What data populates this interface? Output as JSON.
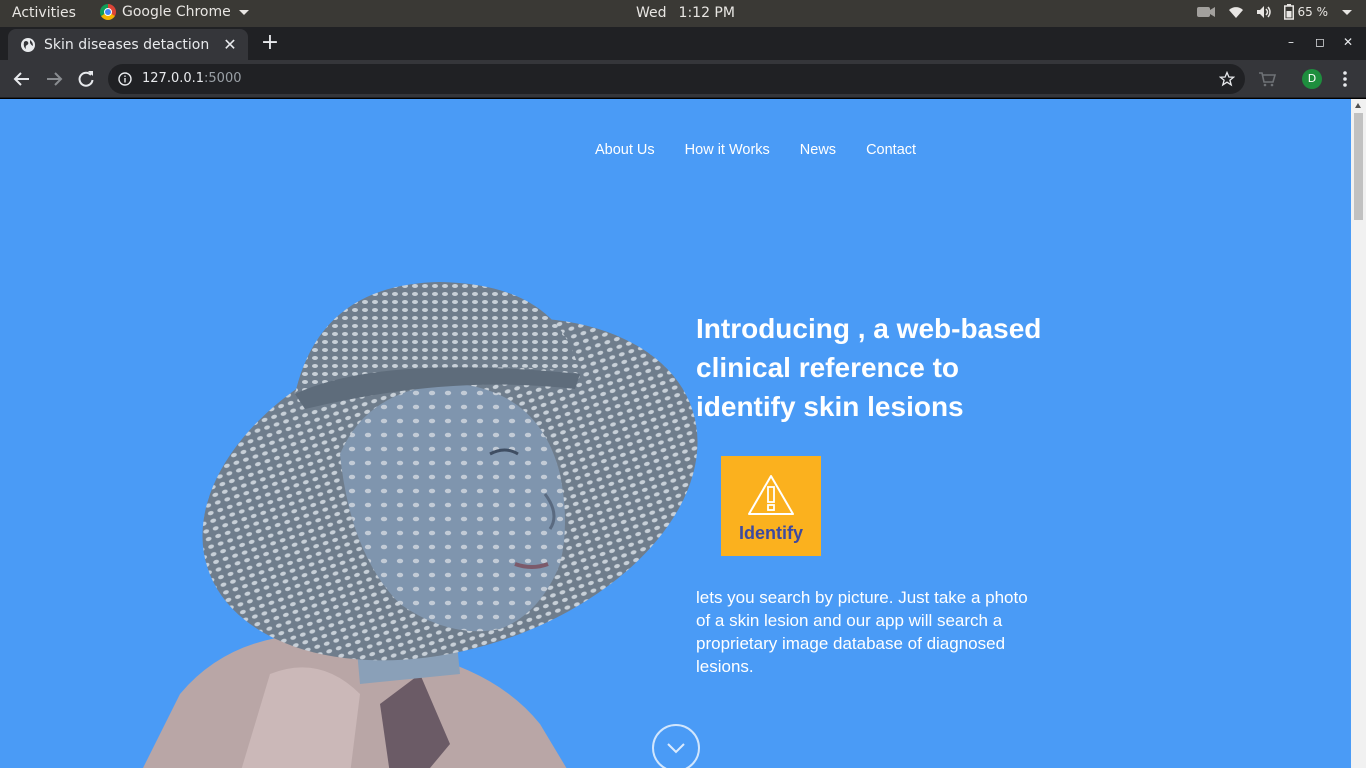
{
  "system_bar": {
    "activities": "Activities",
    "app_name": "Google Chrome",
    "day": "Wed",
    "time": "1:12 PM",
    "battery": "65 %"
  },
  "browser": {
    "tab_title": "Skin diseases detaction",
    "url_host": "127.0.0.1",
    "url_port": ":5000",
    "profile_initial": "D"
  },
  "nav": {
    "items": [
      "About Us",
      "How it Works",
      "News",
      "Contact"
    ]
  },
  "hero": {
    "headline": "Introducing , a web-based clinical reference to identify skin lesions",
    "button_label": "Identify",
    "description": "lets you search by picture. Just take a photo of a skin lesion and our app will search a proprietary image database of diagnosed lesions."
  },
  "colors": {
    "page_background": "#4a9bf6",
    "button_background": "#fbb11e",
    "button_text": "#3d4aa0"
  },
  "icons": {
    "button_icon": "warning-icon",
    "scroll_icon": "chevron-down-icon"
  }
}
